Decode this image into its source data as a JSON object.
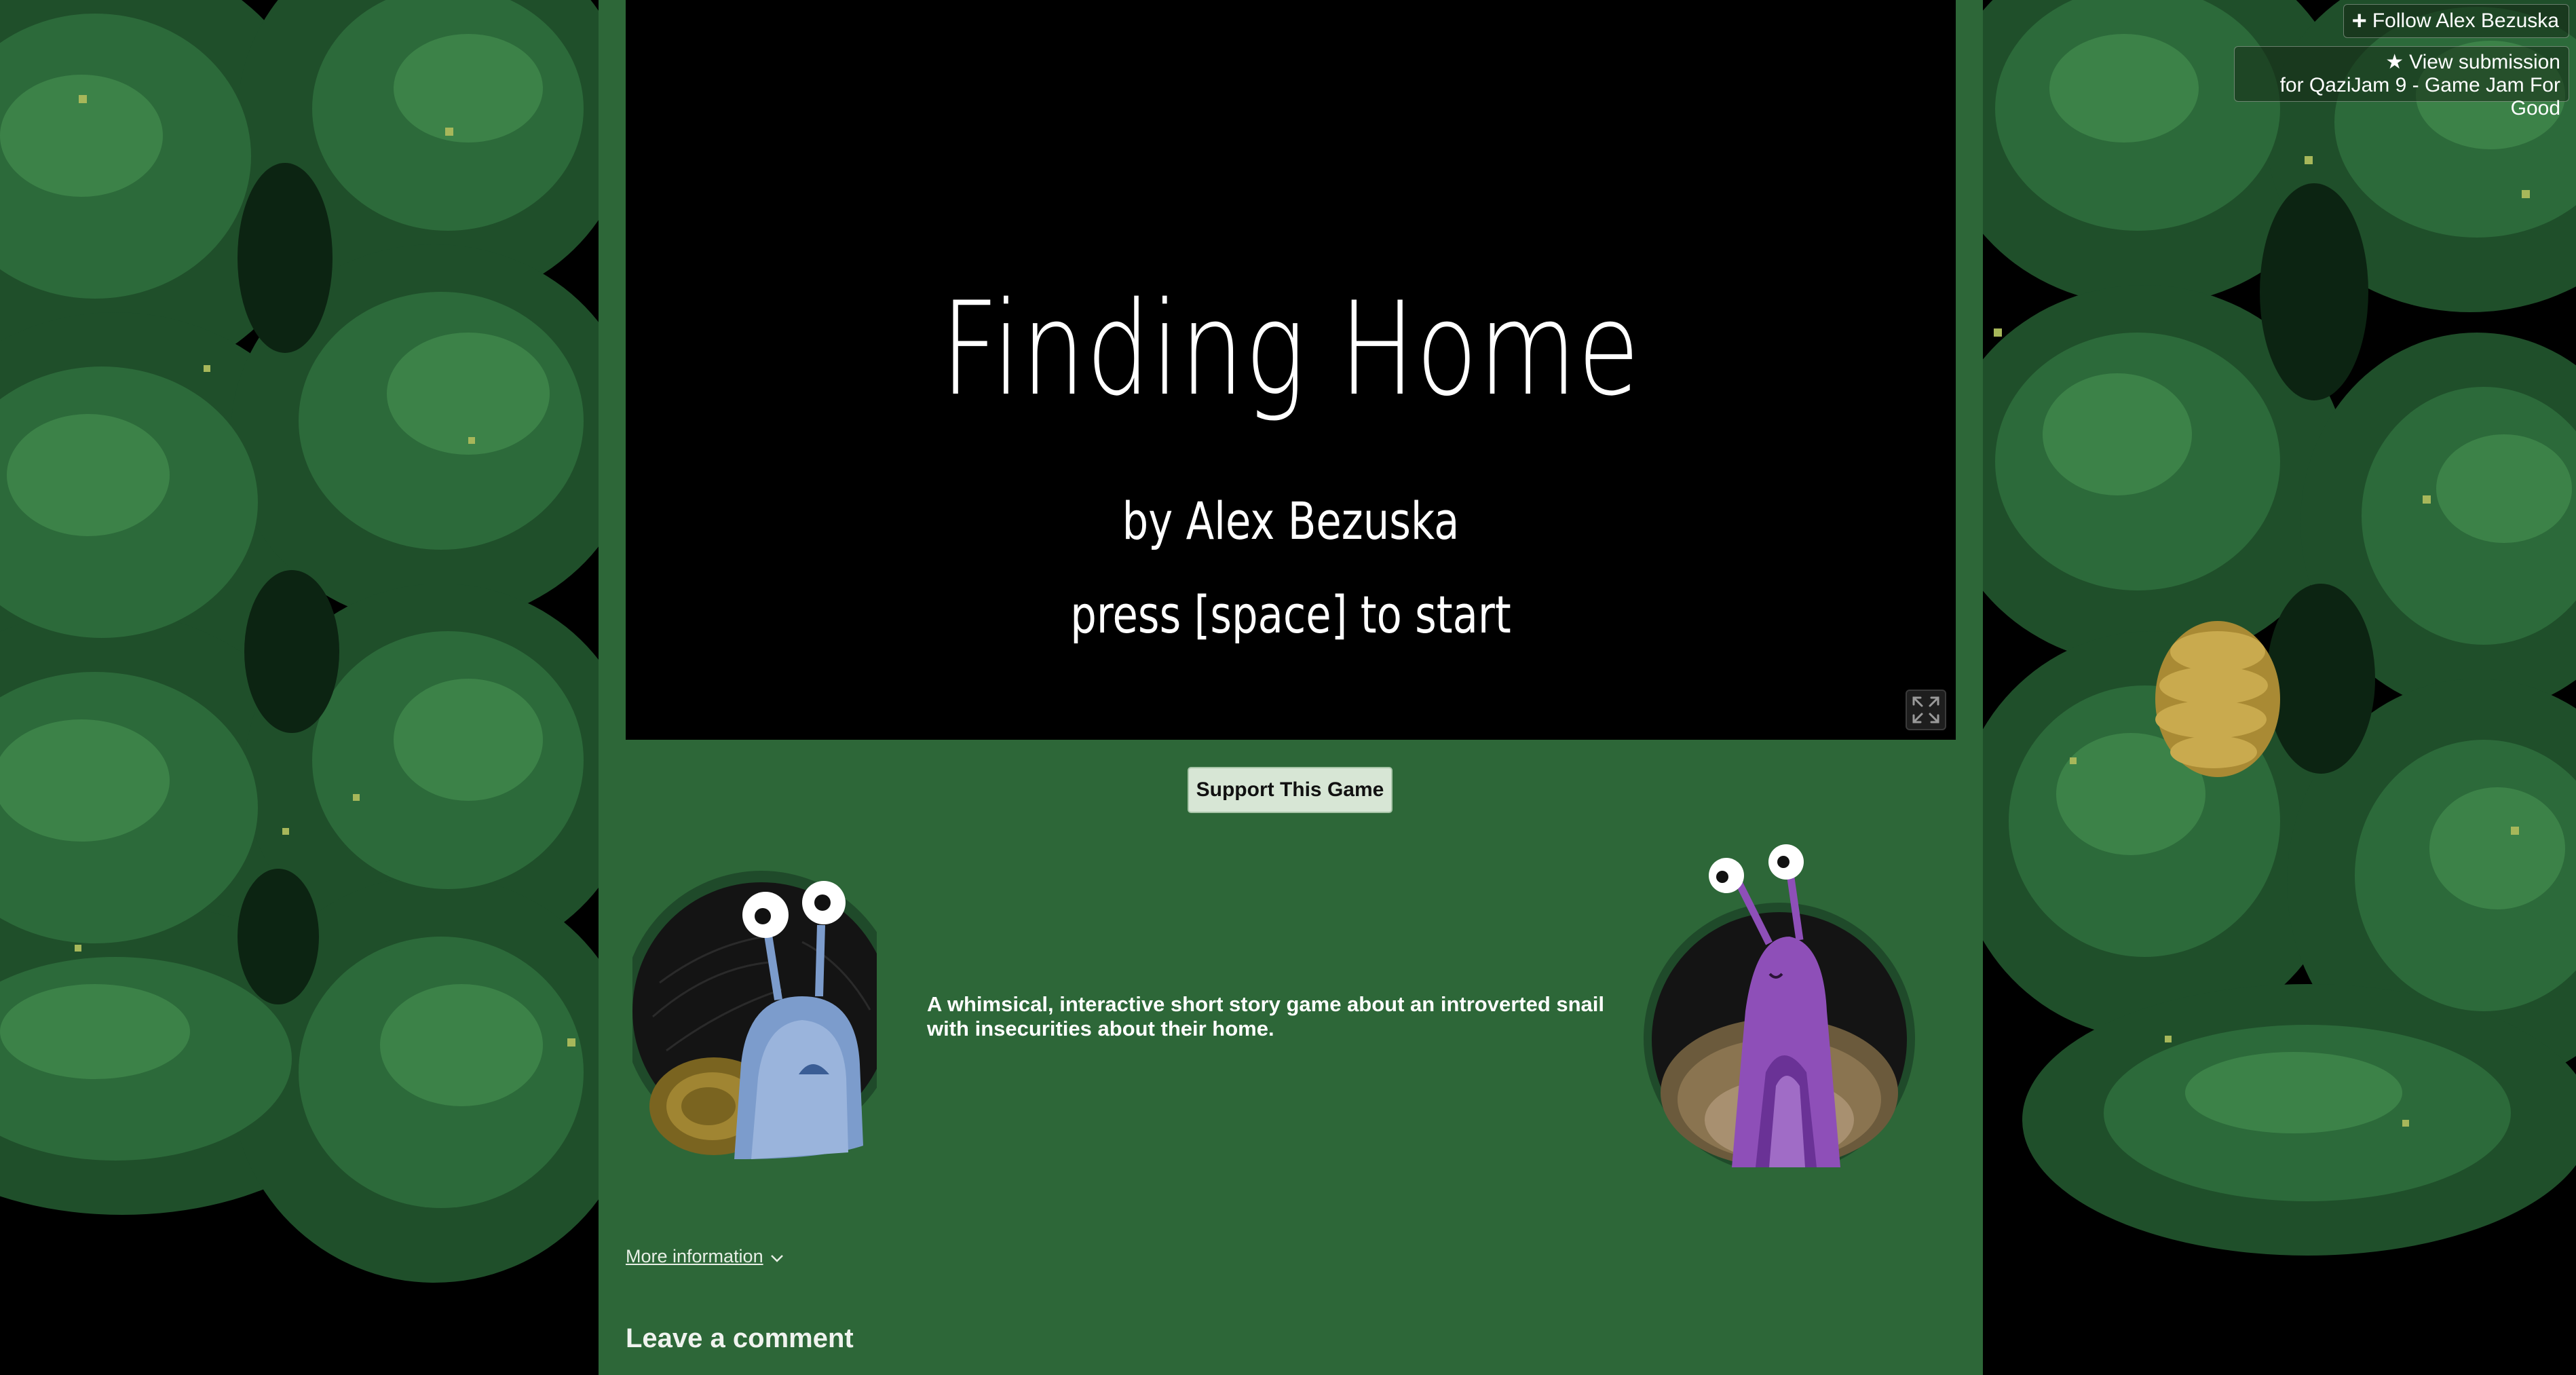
{
  "header": {
    "follow_label": "Follow Alex Bezuska",
    "submission_label": "View submission",
    "submission_jam": "for QaziJam 9 - Game Jam For Good"
  },
  "game": {
    "title": "Finding Home",
    "author_line": "by Alex Bezuska",
    "start_prompt": "press [space] to start"
  },
  "support_label": "Support This Game",
  "description": "A whimsical, interactive short story game about an introverted snail with insecurities about their home.",
  "more_info_label": "More information",
  "comment_heading": "Leave a comment",
  "icons": {
    "follow": "plus-icon",
    "submission": "star-icon",
    "fullscreen": "fullscreen-icon",
    "more_info": "chevron-down-icon"
  },
  "colors": {
    "column_bg": "#2d6738",
    "support_bg": "#d7e6d5",
    "foliage_dark": "#173f22",
    "foliage_mid": "#2c6a3a",
    "foliage_light": "#3f8a4b"
  }
}
